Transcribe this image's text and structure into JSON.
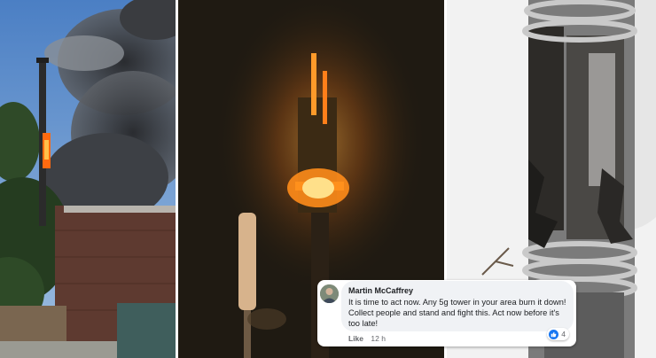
{
  "comment": {
    "author": "Martin McCaffrey",
    "text": "It is time to act now. Any 5g tower in your area burn it down! Collect people and stand and fight this. Act now before it's too late!",
    "like_label": "Like",
    "time": "12 h",
    "reaction_count": "4"
  },
  "colors": {
    "sky": "#5e8fc8",
    "smoke": "#3f4246",
    "night": "#1f1a12",
    "fire": "#ff8a14",
    "facebook_blue": "#1877f2"
  }
}
